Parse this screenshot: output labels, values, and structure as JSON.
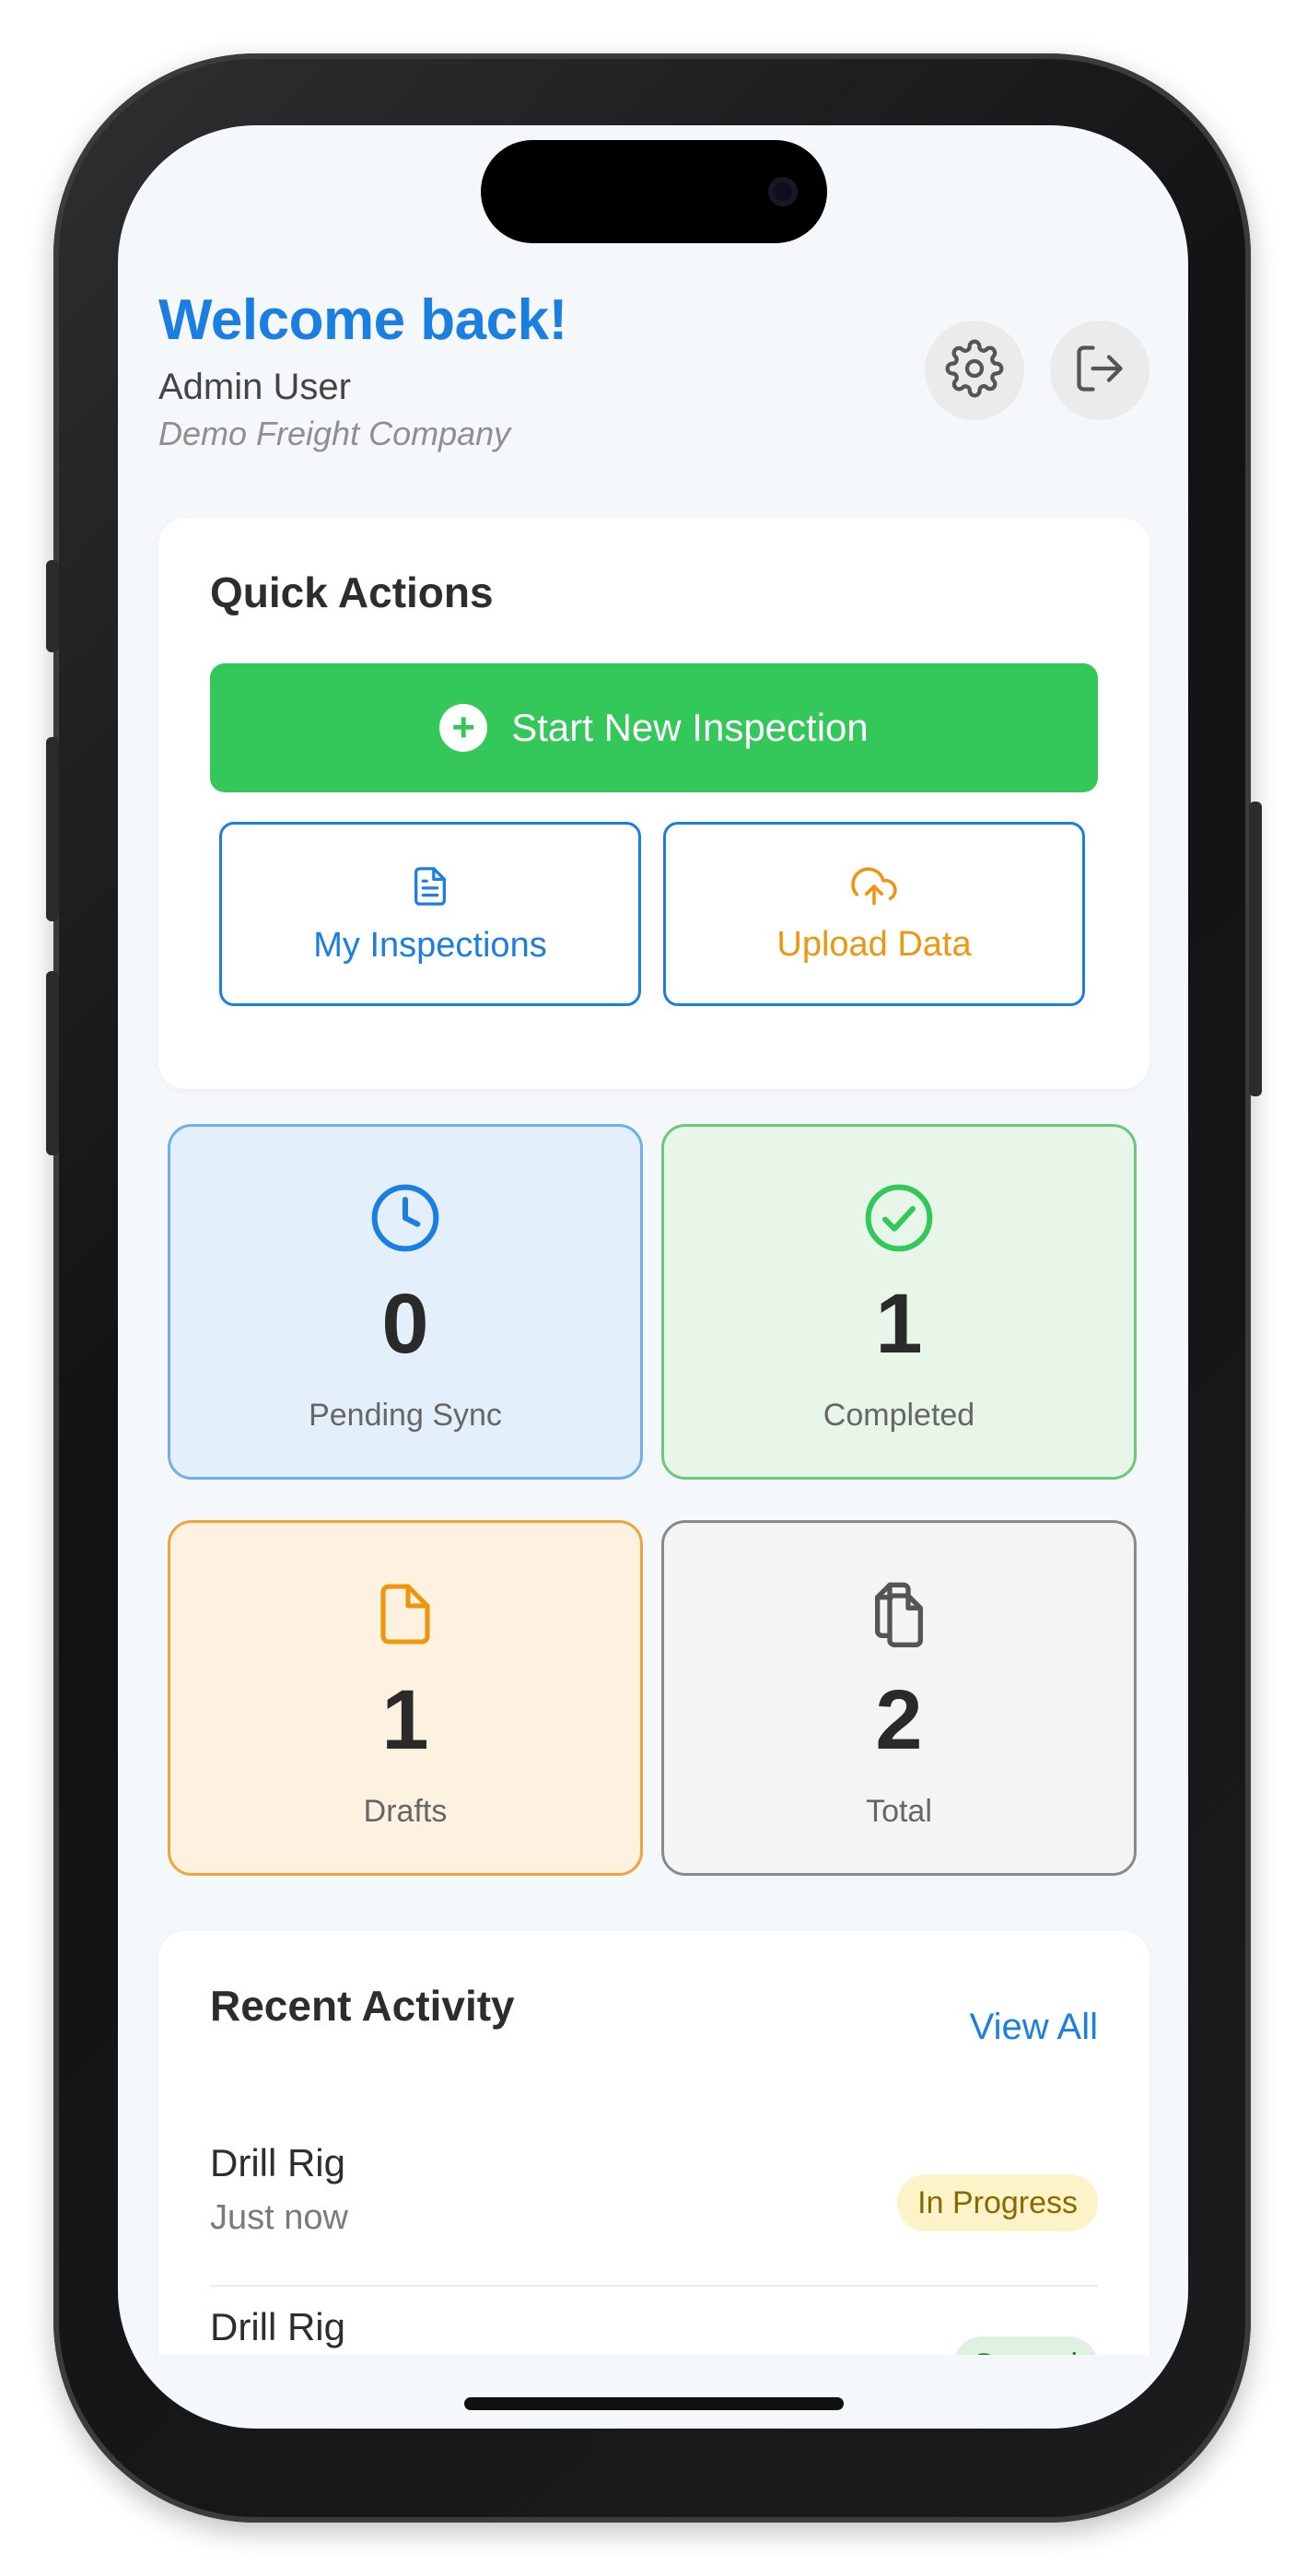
{
  "header": {
    "welcome": "Welcome back!",
    "user_name": "Admin User",
    "company": "Demo Freight Company",
    "settings_icon": "gear-icon",
    "logout_icon": "logout-icon"
  },
  "quick_actions": {
    "title": "Quick Actions",
    "start_label": "Start New Inspection",
    "my_inspections_label": "My Inspections",
    "upload_label": "Upload Data"
  },
  "stats": {
    "pending": {
      "value": "0",
      "label": "Pending Sync"
    },
    "completed": {
      "value": "1",
      "label": "Completed"
    },
    "drafts": {
      "value": "1",
      "label": "Drafts"
    },
    "total": {
      "value": "2",
      "label": "Total"
    }
  },
  "recent": {
    "title": "Recent Activity",
    "view_all": "View All",
    "items": [
      {
        "title": "Drill Rig",
        "time": "Just now",
        "status": "In Progress"
      },
      {
        "title": "Drill Rig",
        "time": "",
        "status": "Synced"
      }
    ]
  },
  "colors": {
    "accent_blue": "#1a7fe0",
    "accent_green": "#34c759",
    "accent_orange": "#f0960e",
    "pending_bg": "#e3f0fc",
    "completed_bg": "#e8f5e9",
    "drafts_bg": "#fdf1df",
    "total_bg": "#f4f4f4"
  }
}
